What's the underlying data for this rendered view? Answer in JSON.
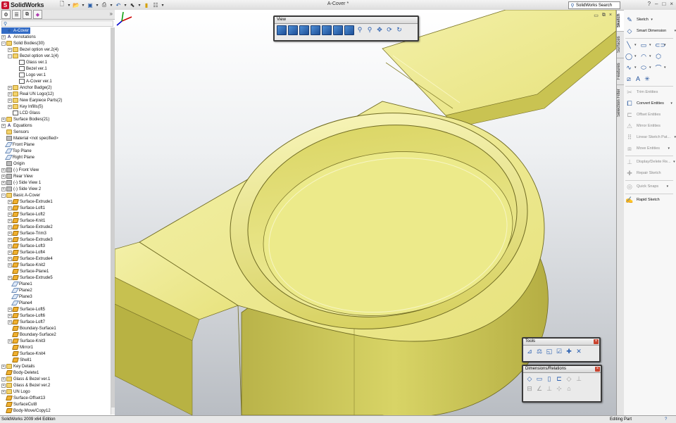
{
  "app": {
    "name": "SolidWorks",
    "doc_title": "A-Cover *",
    "search_placeholder": "SolidWorks Search",
    "window_controls": [
      "?",
      "–",
      "□",
      "×"
    ]
  },
  "quick_access": [
    "new-icon",
    "open-icon",
    "save-icon",
    "print-icon",
    "undo-icon",
    "select-icon",
    "rebuild-icon",
    "options-icon"
  ],
  "tree": {
    "filter_icon": "filter-icon",
    "more": "»",
    "nodes": [
      {
        "label": "A-Cover",
        "depth": 0,
        "icon": "part",
        "exp": "",
        "sel": true
      },
      {
        "label": "Annotations",
        "depth": 0,
        "icon": "text",
        "exp": "+"
      },
      {
        "label": "Solid Bodies(30)",
        "depth": 0,
        "icon": "folder",
        "exp": "−"
      },
      {
        "label": "Bezel option ver.2(4)",
        "depth": 1,
        "icon": "folder",
        "exp": "+"
      },
      {
        "label": "Bezel option ver.1(4)",
        "depth": 1,
        "icon": "folder",
        "exp": "−"
      },
      {
        "label": "Glass ver.1",
        "depth": 2,
        "icon": "body",
        "exp": ""
      },
      {
        "label": "Bezel ver.1",
        "depth": 2,
        "icon": "body",
        "exp": ""
      },
      {
        "label": "Logo ver.1",
        "depth": 2,
        "icon": "body",
        "exp": ""
      },
      {
        "label": "A-Cover ver.1",
        "depth": 2,
        "icon": "body",
        "exp": ""
      },
      {
        "label": "Anchor Badge(2)",
        "depth": 1,
        "icon": "folder",
        "exp": "+"
      },
      {
        "label": "Real UN Logo(12)",
        "depth": 1,
        "icon": "folder",
        "exp": "+"
      },
      {
        "label": "New Earpiece Parts(2)",
        "depth": 1,
        "icon": "folder",
        "exp": "+"
      },
      {
        "label": "Key Infills(5)",
        "depth": 1,
        "icon": "folder",
        "exp": "+"
      },
      {
        "label": "LCD Glass",
        "depth": 1,
        "icon": "body",
        "exp": ""
      },
      {
        "label": "Surface Bodies(21)",
        "depth": 0,
        "icon": "folder",
        "exp": "+"
      },
      {
        "label": "Equations",
        "depth": 0,
        "icon": "text",
        "exp": "+"
      },
      {
        "label": "Sensors",
        "depth": 0,
        "icon": "folder",
        "exp": ""
      },
      {
        "label": "Material <not specified>",
        "depth": 0,
        "icon": "gray",
        "exp": ""
      },
      {
        "label": "Front Plane",
        "depth": 0,
        "icon": "plane",
        "exp": ""
      },
      {
        "label": "Top Plane",
        "depth": 0,
        "icon": "plane",
        "exp": ""
      },
      {
        "label": "Right Plane",
        "depth": 0,
        "icon": "plane",
        "exp": ""
      },
      {
        "label": "Origin",
        "depth": 0,
        "icon": "gray",
        "exp": ""
      },
      {
        "label": "(-) Front View",
        "depth": 0,
        "icon": "gray",
        "exp": "+"
      },
      {
        "label": "Rear View",
        "depth": 0,
        "icon": "gray",
        "exp": "+"
      },
      {
        "label": "(-) Side View 1",
        "depth": 0,
        "icon": "gray",
        "exp": "+"
      },
      {
        "label": "(-) Side View 2",
        "depth": 0,
        "icon": "gray",
        "exp": "+"
      },
      {
        "label": "Basic A-Cover",
        "depth": 0,
        "icon": "folder",
        "exp": "−"
      },
      {
        "label": "Surface-Extrude1",
        "depth": 1,
        "icon": "feat",
        "exp": "+"
      },
      {
        "label": "Surface-Loft1",
        "depth": 1,
        "icon": "feat",
        "exp": "+"
      },
      {
        "label": "Surface-Loft2",
        "depth": 1,
        "icon": "feat",
        "exp": "+"
      },
      {
        "label": "Surface-Knit1",
        "depth": 1,
        "icon": "feat",
        "exp": "+"
      },
      {
        "label": "Surface-Extrude2",
        "depth": 1,
        "icon": "feat",
        "exp": "+"
      },
      {
        "label": "Surface-Trim3",
        "depth": 1,
        "icon": "feat",
        "exp": "+"
      },
      {
        "label": "Surface-Extrude3",
        "depth": 1,
        "icon": "feat",
        "exp": "+"
      },
      {
        "label": "Surface-Loft3",
        "depth": 1,
        "icon": "feat",
        "exp": "+"
      },
      {
        "label": "Surface-Loft4",
        "depth": 1,
        "icon": "feat",
        "exp": "+"
      },
      {
        "label": "Surface-Extrude4",
        "depth": 1,
        "icon": "feat",
        "exp": "+"
      },
      {
        "label": "Surface-Knit2",
        "depth": 1,
        "icon": "feat",
        "exp": "+"
      },
      {
        "label": "Surface-Plane1",
        "depth": 1,
        "icon": "feat",
        "exp": ""
      },
      {
        "label": "Surface-Extrude5",
        "depth": 1,
        "icon": "feat",
        "exp": "+"
      },
      {
        "label": "Plane1",
        "depth": 1,
        "icon": "plane",
        "exp": ""
      },
      {
        "label": "Plane2",
        "depth": 1,
        "icon": "plane",
        "exp": ""
      },
      {
        "label": "Plane3",
        "depth": 1,
        "icon": "plane",
        "exp": ""
      },
      {
        "label": "Plane4",
        "depth": 1,
        "icon": "plane",
        "exp": ""
      },
      {
        "label": "Surface-Loft5",
        "depth": 1,
        "icon": "feat",
        "exp": "+"
      },
      {
        "label": "Surface-Loft6",
        "depth": 1,
        "icon": "feat",
        "exp": "+"
      },
      {
        "label": "Surface-Loft7",
        "depth": 1,
        "icon": "feat",
        "exp": "+"
      },
      {
        "label": "Boundary-Surface1",
        "depth": 1,
        "icon": "feat",
        "exp": ""
      },
      {
        "label": "Boundary-Surface2",
        "depth": 1,
        "icon": "feat",
        "exp": ""
      },
      {
        "label": "Surface-Knit3",
        "depth": 1,
        "icon": "feat",
        "exp": "+"
      },
      {
        "label": "Mirror1",
        "depth": 1,
        "icon": "feat",
        "exp": ""
      },
      {
        "label": "Surface-Knit4",
        "depth": 1,
        "icon": "feat",
        "exp": ""
      },
      {
        "label": "Shell1",
        "depth": 1,
        "icon": "feat",
        "exp": ""
      },
      {
        "label": "Key Details",
        "depth": 0,
        "icon": "folder",
        "exp": "+"
      },
      {
        "label": "Body-Delete1",
        "depth": 0,
        "icon": "feat",
        "exp": ""
      },
      {
        "label": "Glass & Bezel ver.1",
        "depth": 0,
        "icon": "folder",
        "exp": "+"
      },
      {
        "label": "Glass & Bezel ver.2",
        "depth": 0,
        "icon": "folder",
        "exp": "+"
      },
      {
        "label": "UN Logo",
        "depth": 0,
        "icon": "folder",
        "exp": "+"
      },
      {
        "label": "Surface-Offset13",
        "depth": 0,
        "icon": "feat",
        "exp": ""
      },
      {
        "label": "SurfaceCut8",
        "depth": 0,
        "icon": "feat",
        "exp": ""
      },
      {
        "label": "Body-Move/Copy12",
        "depth": 0,
        "icon": "feat",
        "exp": ""
      }
    ]
  },
  "view_toolbar": {
    "title": "View",
    "icons": [
      "front-view-icon",
      "back-view-icon",
      "left-view-icon",
      "right-view-icon",
      "top-view-icon",
      "bottom-view-icon",
      "isometric-view-icon",
      "zoom-to-fit-icon",
      "zoom-to-area-icon",
      "pan-icon",
      "rotate-icon",
      "redraw-icon"
    ]
  },
  "tools_toolbar": {
    "title": "Tools",
    "icons": [
      "measure-icon",
      "mass-properties-icon",
      "section-properties-icon",
      "check-icon",
      "import-diagnostics-icon",
      "deviation-analysis-icon"
    ]
  },
  "dims_toolbar": {
    "title": "Dimensions/Relations",
    "icons_row1": [
      "smart-dimension-icon",
      "horizontal-dimension-icon",
      "vertical-dimension-icon",
      "baseline-dimension-icon",
      "add-relation-icon",
      "display-relations-icon"
    ],
    "icons_row2": [
      "ordinate-dimension-icon",
      "angular-dimension-icon",
      "chamfer-dimension-icon",
      "fully-define-icon",
      "scan-equal-icon"
    ]
  },
  "right_tabs": [
    "Sketch",
    "Surfaces",
    "Features",
    "Selection Filter"
  ],
  "right_panel": {
    "sketch": "Sketch",
    "smart_dimension": "Smart Dimension",
    "trim_entities": "Trim Entities",
    "convert_entities": "Convert Entities",
    "offset_entities": "Offset Entities",
    "mirror_entities": "Mirror Entities",
    "linear_sketch_pattern": "Linear Sketch Pat...",
    "move_entities": "Move Entities",
    "display_delete_relations": "Display/Delete Re...",
    "repair_sketch": "Repair Sketch",
    "quick_snaps": "Quick Snaps",
    "rapid_sketch": "Rapid Sketch"
  },
  "status": {
    "edition": "SolidWorks 2009 x64 Edition",
    "mode": "Editing Part",
    "help_icon": "help-icon"
  },
  "colors": {
    "model_face": "#ecea8a",
    "model_side": "#c9c455",
    "selected_item": "#316ac5"
  }
}
